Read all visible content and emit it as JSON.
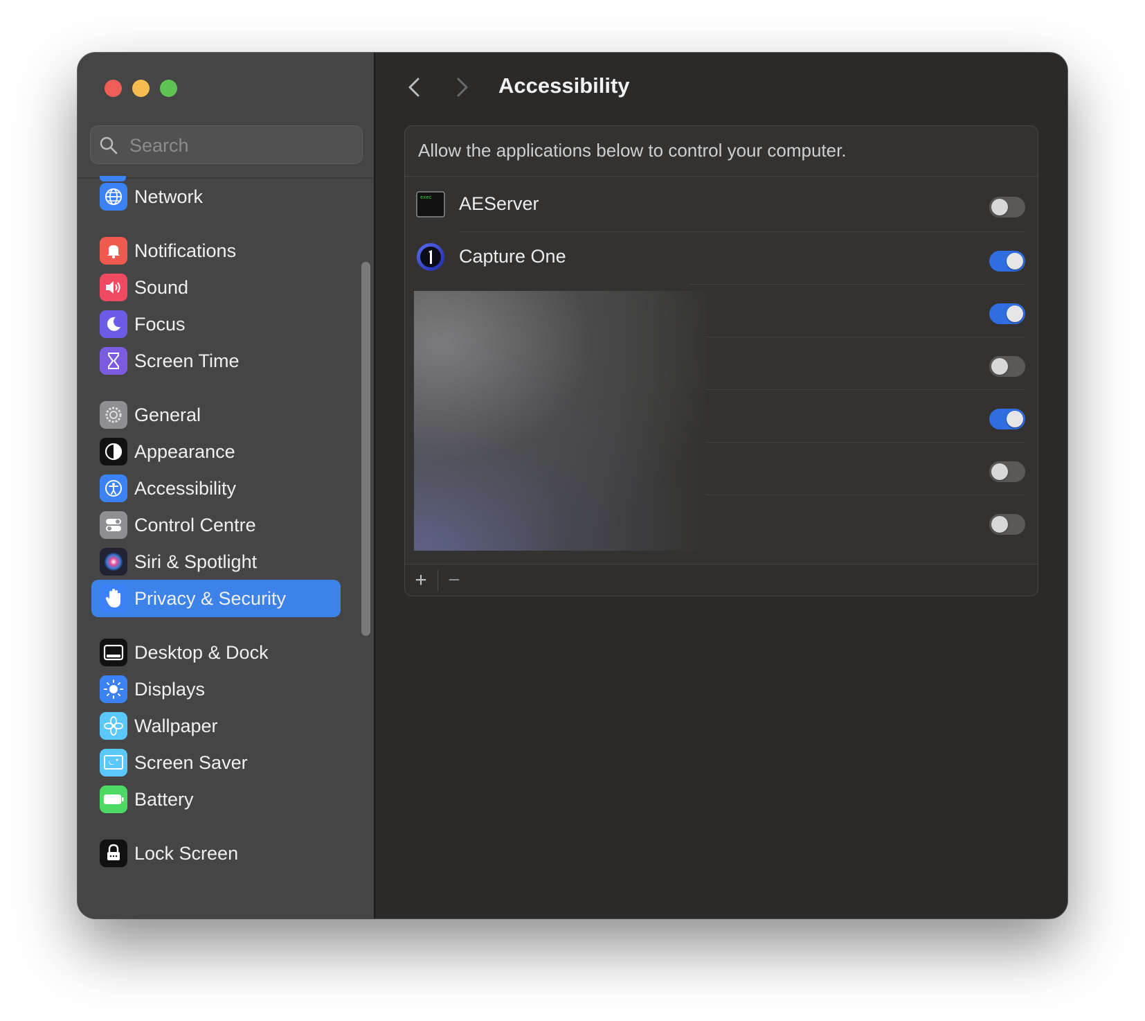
{
  "window": {
    "title": "Accessibility"
  },
  "sidebar": {
    "search": {
      "placeholder": "Search",
      "value": ""
    },
    "items": [
      {
        "label": "Network",
        "icon": "globe-icon",
        "color": "#3b82f6",
        "selected": false
      },
      {
        "label": "Notifications",
        "icon": "bell-icon",
        "color": "#ef5a4f",
        "selected": false
      },
      {
        "label": "Sound",
        "icon": "speaker-icon",
        "color": "#ef4a62",
        "selected": false
      },
      {
        "label": "Focus",
        "icon": "moon-icon",
        "color": "#6b5ce7",
        "selected": false
      },
      {
        "label": "Screen Time",
        "icon": "hourglass-icon",
        "color": "#7b5ce0",
        "selected": false
      },
      {
        "label": "General",
        "icon": "gear-icon",
        "color": "#8e8e93",
        "selected": false
      },
      {
        "label": "Appearance",
        "icon": "appearance-icon",
        "color": "#111111",
        "selected": false
      },
      {
        "label": "Accessibility",
        "icon": "accessibility-icon",
        "color": "#3b82f6",
        "selected": false
      },
      {
        "label": "Control Centre",
        "icon": "switches-icon",
        "color": "#8e8e93",
        "selected": false
      },
      {
        "label": "Siri & Spotlight",
        "icon": "siri-icon",
        "color": "#222233",
        "selected": false
      },
      {
        "label": "Privacy & Security",
        "icon": "hand-icon",
        "color": "#3b82f6",
        "selected": true
      },
      {
        "label": "Desktop & Dock",
        "icon": "dock-icon",
        "color": "#111111",
        "selected": false
      },
      {
        "label": "Displays",
        "icon": "sun-icon",
        "color": "#3b82f6",
        "selected": false
      },
      {
        "label": "Wallpaper",
        "icon": "flower-icon",
        "color": "#5ac8fa",
        "selected": false
      },
      {
        "label": "Screen Saver",
        "icon": "screensaver-icon",
        "color": "#5ac8fa",
        "selected": false
      },
      {
        "label": "Battery",
        "icon": "battery-icon",
        "color": "#4cd964",
        "selected": false
      },
      {
        "label": "Lock Screen",
        "icon": "lock-icon",
        "color": "#111111",
        "selected": false
      }
    ]
  },
  "main": {
    "title": "Accessibility",
    "description": "Allow the applications below to control your computer.",
    "apps": [
      {
        "name": "AEServer",
        "icon": "exec-terminal-icon",
        "enabled": false
      },
      {
        "name": "Capture One",
        "icon": "capture-one-icon",
        "enabled": true
      },
      {
        "name": "",
        "enabled": true
      },
      {
        "name": "",
        "enabled": false
      },
      {
        "name": "",
        "enabled": true
      },
      {
        "name": "",
        "enabled": false
      },
      {
        "name": "",
        "enabled": false
      }
    ],
    "footer": {
      "add_label": "+",
      "remove_label": "−"
    }
  },
  "colors": {
    "accent": "#3d82e9",
    "toggle_on": "#2f6de1",
    "toggle_off": "#5a5957"
  }
}
